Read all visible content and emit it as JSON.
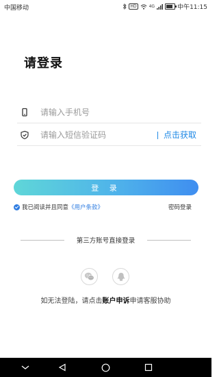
{
  "status_bar": {
    "carrier": "中国移动",
    "hd_badge": "HD",
    "network": "4G",
    "time": "中午11:15",
    "icons": [
      "bluetooth-icon",
      "hd-voice-icon",
      "wifi-icon",
      "signal-icon",
      "battery-icon"
    ]
  },
  "login": {
    "title": "请登录",
    "phone_placeholder": "请输入手机号",
    "phone_value": "",
    "code_placeholder": "请输入短信验证码",
    "code_value": "",
    "get_code_label": "点击获取",
    "login_button": "登 录",
    "agree_text": "我已阅读并且同意",
    "terms_link": "《用户条款》",
    "agree_checked": true,
    "password_login": "密码登录"
  },
  "third_party": {
    "label": "第三方账号直接登录",
    "providers": [
      "wechat-icon",
      "qq-icon"
    ]
  },
  "appeal": {
    "prefix": "如无法登陆，请点击",
    "link": "账户申诉",
    "suffix": "申请客服协助"
  },
  "nav_bar": {
    "icons": [
      "collapse-icon",
      "back-icon",
      "home-icon",
      "recents-icon"
    ]
  },
  "colors": {
    "accent": "#1e88e5",
    "button_gradient_start": "#5fd6d8",
    "button_gradient_end": "#3f8ef0",
    "nav_bar": "#000000"
  }
}
